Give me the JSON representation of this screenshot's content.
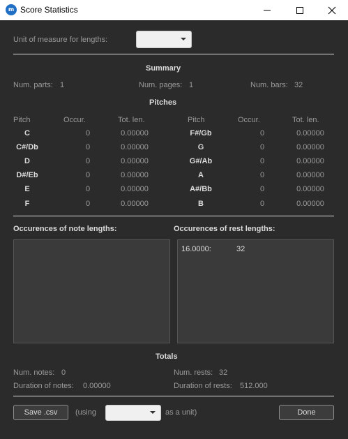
{
  "window": {
    "title": "Score Statistics",
    "icon": "musescore-icon",
    "app_icon_text": "m"
  },
  "unit_row": {
    "label": "Unit of measure for lengths:",
    "value": ""
  },
  "summary": {
    "heading": "Summary",
    "parts_label": "Num. parts:",
    "parts_value": "1",
    "pages_label": "Num. pages:",
    "pages_value": "1",
    "bars_label": "Num. bars:",
    "bars_value": "32"
  },
  "pitches": {
    "heading": "Pitches",
    "headers": {
      "pitch": "Pitch",
      "occur": "Occur.",
      "totlen": "Tot. len."
    },
    "rows": [
      {
        "left": {
          "pitch": "C",
          "occur": "0",
          "len": "0.00000"
        },
        "right": {
          "pitch": "F#/Gb",
          "occur": "0",
          "len": "0.00000"
        }
      },
      {
        "left": {
          "pitch": "C#/Db",
          "occur": "0",
          "len": "0.00000"
        },
        "right": {
          "pitch": "G",
          "occur": "0",
          "len": "0.00000"
        }
      },
      {
        "left": {
          "pitch": "D",
          "occur": "0",
          "len": "0.00000"
        },
        "right": {
          "pitch": "G#/Ab",
          "occur": "0",
          "len": "0.00000"
        }
      },
      {
        "left": {
          "pitch": "D#/Eb",
          "occur": "0",
          "len": "0.00000"
        },
        "right": {
          "pitch": "A",
          "occur": "0",
          "len": "0.00000"
        }
      },
      {
        "left": {
          "pitch": "E",
          "occur": "0",
          "len": "0.00000"
        },
        "right": {
          "pitch": "A#/Bb",
          "occur": "0",
          "len": "0.00000"
        }
      },
      {
        "left": {
          "pitch": "F",
          "occur": "0",
          "len": "0.00000"
        },
        "right": {
          "pitch": "B",
          "occur": "0",
          "len": "0.00000"
        }
      }
    ]
  },
  "note_lengths": {
    "heading": "Occurences of note lengths:",
    "items": []
  },
  "rest_lengths": {
    "heading": "Occurences of rest lengths:",
    "items": [
      {
        "length": "16.0000:",
        "count": "32"
      }
    ]
  },
  "totals": {
    "heading": "Totals",
    "notes_label": "Num. notes:",
    "notes_value": "0",
    "rests_label": "Num. rests:",
    "rests_value": "32",
    "note_dur_label": "Duration of notes:",
    "note_dur_value": "0.00000",
    "rest_dur_label": "Duration of rests:",
    "rest_dur_value": "512.000"
  },
  "footer": {
    "save_label": "Save .csv",
    "using_label": "(using",
    "unit_value": "",
    "as_unit_label": "as a unit)",
    "done_label": "Done"
  }
}
